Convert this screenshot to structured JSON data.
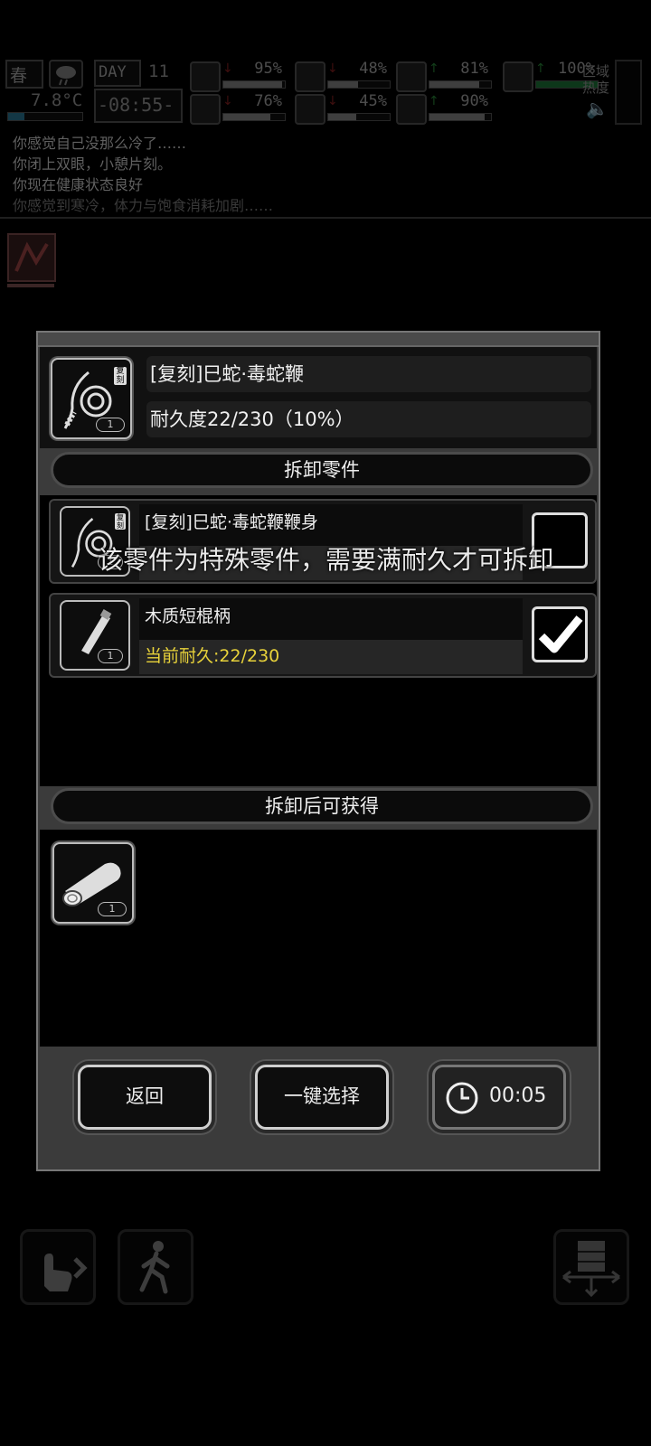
{
  "hud": {
    "season": "春",
    "day_label": "DAY",
    "day_number": "11",
    "temperature": "7.8°C",
    "time": "-08:55-",
    "stats": [
      {
        "value": "95%",
        "trend": "down",
        "color": "#8a8a8a",
        "level": 0.95
      },
      {
        "value": "48%",
        "trend": "down",
        "color": "#8a8a8a",
        "level": 0.48
      },
      {
        "value": "81%",
        "trend": "up",
        "color": "#8a8a8a",
        "level": 0.81
      },
      {
        "value": "76%",
        "trend": "down",
        "color": "#8a8a8a",
        "level": 0.76
      },
      {
        "value": "45%",
        "trend": "down",
        "color": "#8a8a8a",
        "level": 0.45
      },
      {
        "value": "90%",
        "trend": "up",
        "color": "#8a8a8a",
        "level": 0.9
      },
      {
        "value": "100%",
        "trend": "up",
        "color": "#1e7a3a",
        "level": 1.0
      }
    ],
    "region_heat": "区域\n热度"
  },
  "log": [
    "你感觉自己没那么冷了……",
    "你闭上双眼，小憩片刻。",
    "你现在健康状态良好",
    "你感觉到寒冷，体力与饱食消耗加剧……"
  ],
  "modal": {
    "item": {
      "name": "[复刻]巳蛇·毒蛇鞭",
      "durability": "耐久度22/230（10%）",
      "qty": "1",
      "badge": "复刻",
      "icon": "whip-icon"
    },
    "parts_header": "拆卸零件",
    "parts": [
      {
        "name": "[复刻]巳蛇·毒蛇鞭鞭身",
        "durability": "",
        "qty": "1",
        "icon": "whip-icon",
        "checked": false
      },
      {
        "name": "木质短棍柄",
        "durability": "当前耐久:22/230",
        "qty": "1",
        "icon": "stick-handle-icon",
        "checked": true
      }
    ],
    "toast": "该零件为特殊零件，需要满耐久才可拆卸",
    "gain_header": "拆卸后可获得",
    "gain_items": [
      {
        "qty": "1",
        "icon": "wood-log-icon"
      }
    ],
    "buttons": {
      "back": "返回",
      "select_all": "一键选择",
      "timer": "00:05"
    }
  }
}
